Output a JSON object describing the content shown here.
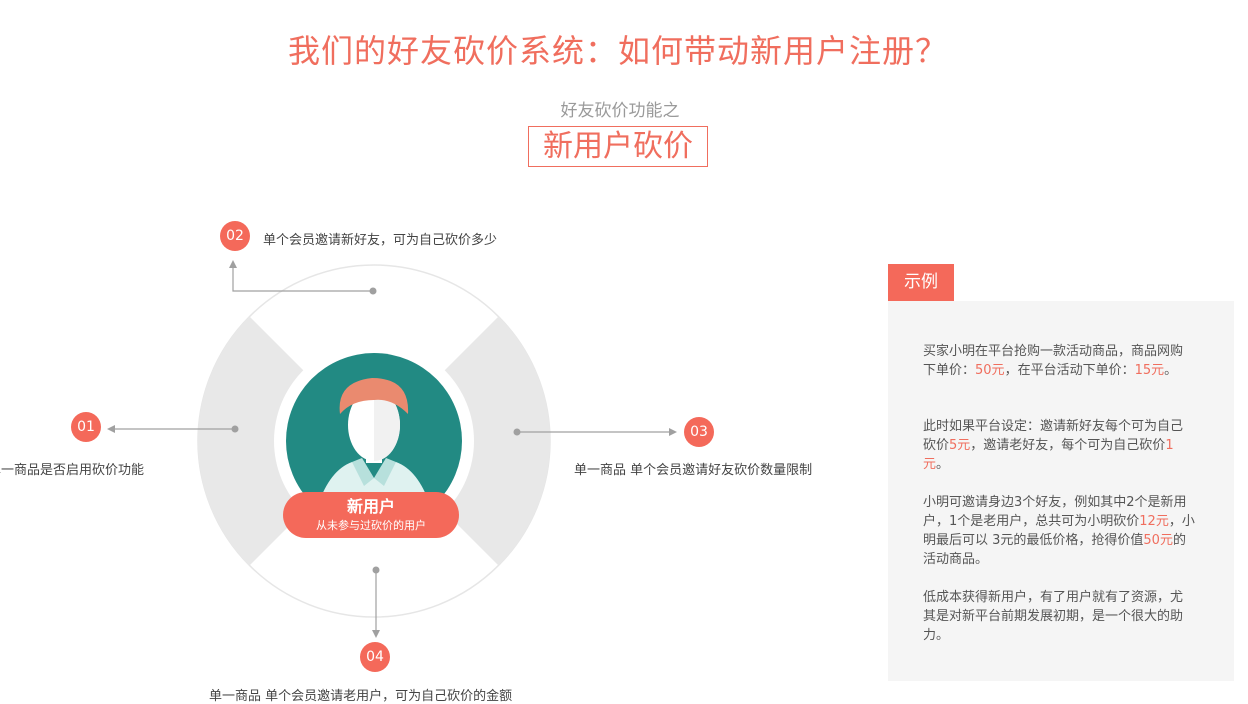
{
  "header": {
    "title": "我们的好友砍价系统：如何带动新用户注册？",
    "subtitle": "好友砍价功能之",
    "feature": "新用户砍价"
  },
  "diagram": {
    "center": {
      "title": "新用户",
      "subtitle": "从未参与过砍价的用户"
    },
    "points": [
      {
        "number": "01",
        "label": "单一商品是否启用砍价功能"
      },
      {
        "number": "02",
        "label": "单个会员邀请新好友，可为自己砍价多少"
      },
      {
        "number": "03",
        "label": "单一商品  单个会员邀请好友砍价数量限制"
      },
      {
        "number": "04",
        "label": "单一商品  单个会员邀请老用户，可为自己砍价的金额"
      }
    ],
    "colors": {
      "accent": "#f4695a",
      "teal": "#228a83",
      "ring": "#e8e8e8",
      "hair": "#ea8a6f",
      "shirt": "#dff2f0"
    }
  },
  "example": {
    "tab_label": "示例",
    "paragraphs": [
      [
        {
          "t": "买家小明在平台抢购一款活动商品，商品网购下单价："
        },
        {
          "t": "50元",
          "hl": true
        },
        {
          "t": "，在平台活动下单价："
        },
        {
          "t": "15元",
          "hl": true
        },
        {
          "t": "。"
        }
      ],
      [
        {
          "t": "此时如果平台设定：邀请新好友每个可为自己砍价"
        },
        {
          "t": "5元",
          "hl": true
        },
        {
          "t": "，邀请老好友，每个可为自己砍价"
        },
        {
          "t": "1元",
          "hl": true
        },
        {
          "t": "。"
        }
      ],
      [
        {
          "t": "小明可邀请身边3个好友，例如其中2个是新用户，1个是老用户，总共可为小明砍价"
        },
        {
          "t": "12元",
          "hl": true
        },
        {
          "t": "，小明最后可以 3元的最低价格，抢得价值"
        },
        {
          "t": "50元",
          "hl": true
        },
        {
          "t": "的活动商品。"
        }
      ],
      [
        {
          "t": "低成本获得新用户，有了用户就有了资源，尤其是对新平台前期发展初期，是一个很大的助力。"
        }
      ]
    ]
  }
}
